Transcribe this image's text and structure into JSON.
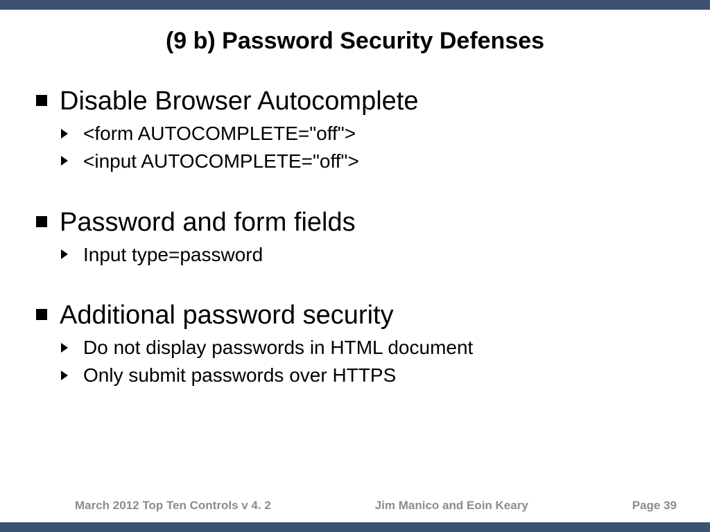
{
  "title": "(9 b) Password Security Defenses",
  "bullets": {
    "b1": {
      "heading": "Disable Browser Autocomplete",
      "items": [
        "<form AUTOCOMPLETE=\"off\">",
        "<input AUTOCOMPLETE=\"off\">"
      ]
    },
    "b2": {
      "heading": "Password and form fields",
      "items": [
        "Input type=password"
      ]
    },
    "b3": {
      "heading": "Additional password security",
      "items": [
        "Do not display passwords in HTML document",
        "Only submit passwords over HTTPS"
      ]
    }
  },
  "footer": {
    "left": "March 2012  Top Ten Controls v 4. 2",
    "center": "Jim Manico and Eoin Keary",
    "right": "Page 39"
  }
}
